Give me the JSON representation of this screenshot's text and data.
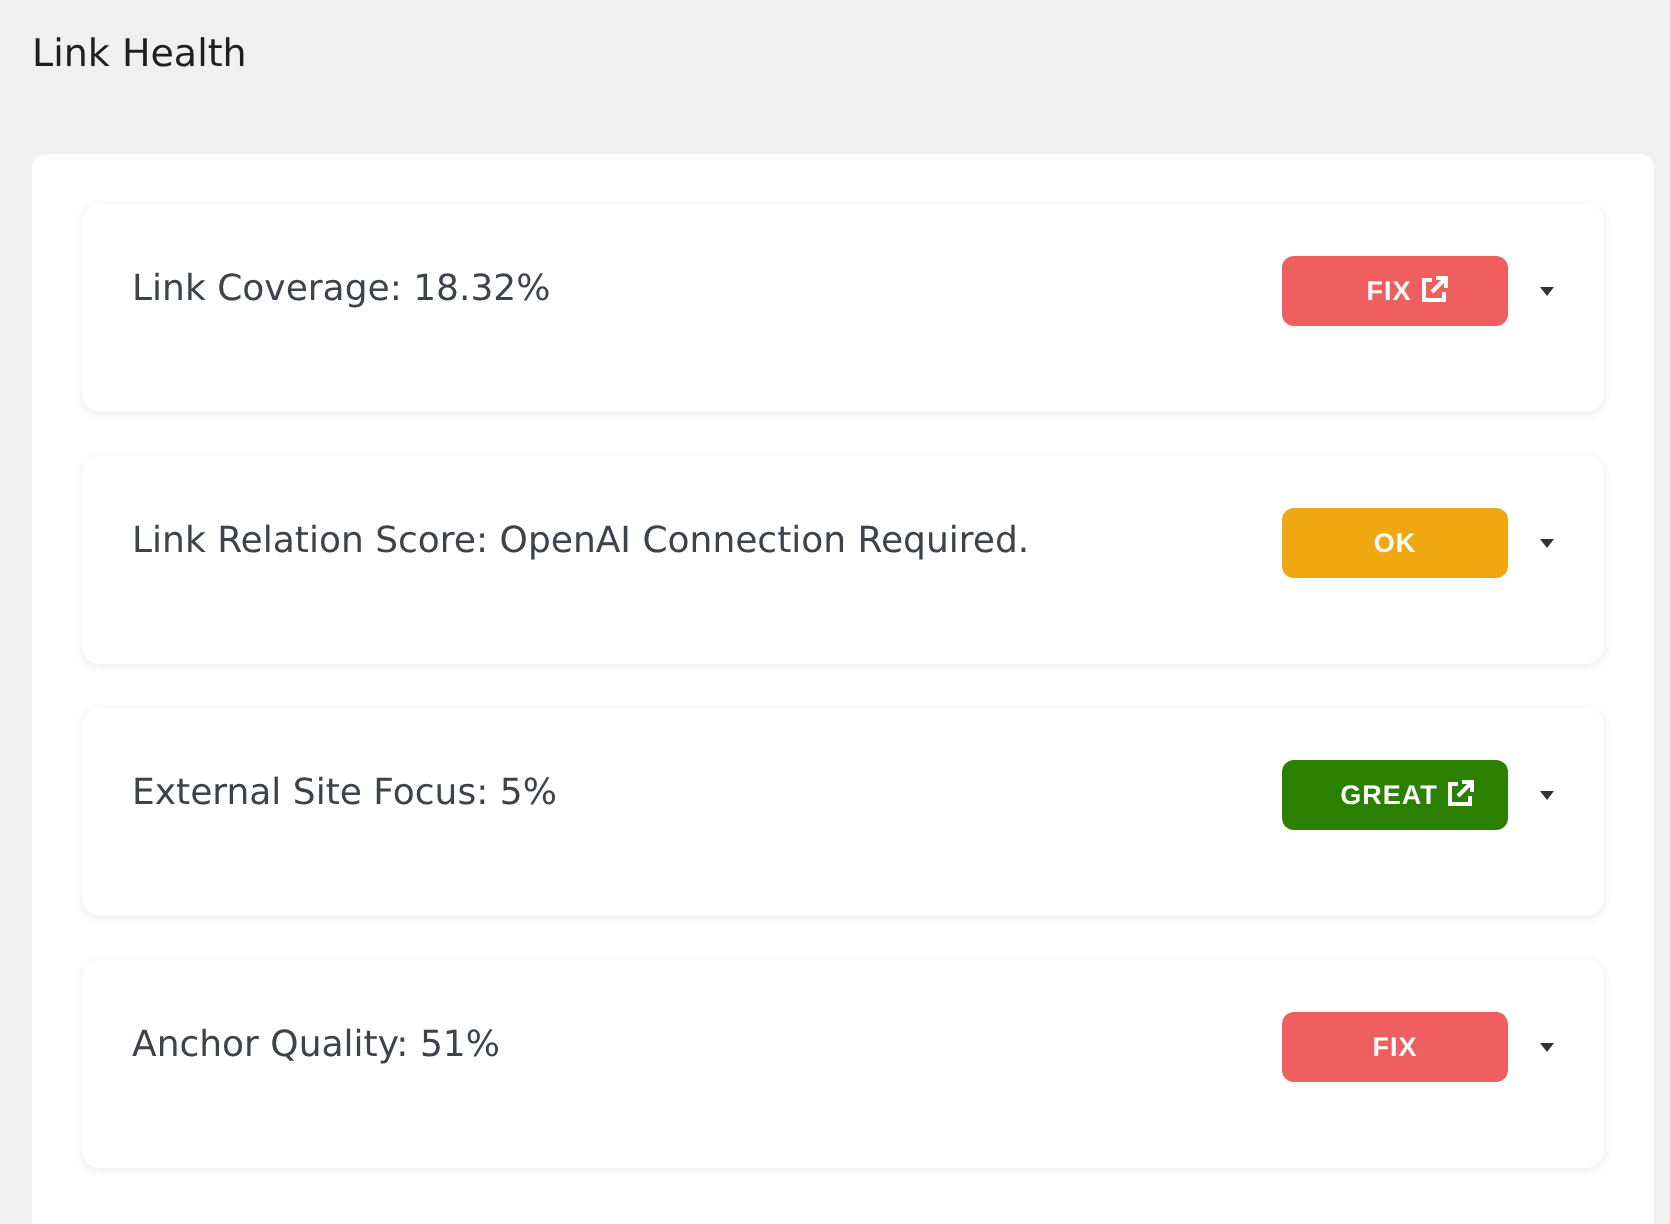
{
  "title": "Link Health",
  "metrics": [
    {
      "label": "Link Coverage: 18.32%",
      "badge": {
        "text": "FIX",
        "color": "#f05f5f",
        "external": true
      },
      "expanded": false
    },
    {
      "label": "Link Relation Score: OpenAI Connection Required.",
      "badge": {
        "text": "OK",
        "color": "#f0a712",
        "external": false
      },
      "expanded": false
    },
    {
      "label": "External Site Focus: 5%",
      "badge": {
        "text": "GREAT",
        "color": "#2b8000",
        "external": true
      },
      "expanded": false
    },
    {
      "label": "Anchor Quality: 51%",
      "badge": {
        "text": "FIX",
        "color": "#f05f5f",
        "external": false
      },
      "expanded": false
    }
  ]
}
